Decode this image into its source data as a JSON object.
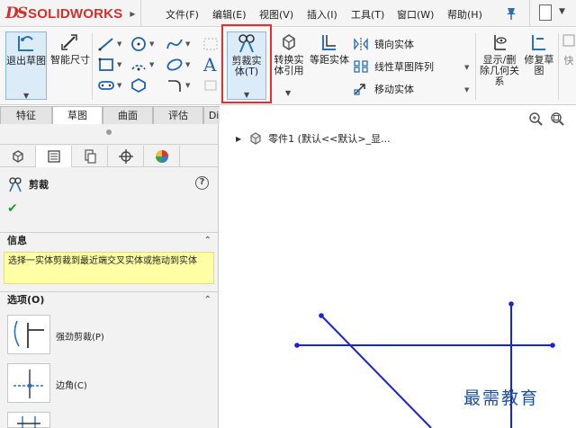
{
  "app": {
    "logo_text": "SOLIDWORKS",
    "logo_mark": "DS",
    "accent_color": "#d0312d"
  },
  "menu": {
    "items": [
      "文件(F)",
      "编辑(E)",
      "视图(V)",
      "插入(I)",
      "工具(T)",
      "窗口(W)",
      "帮助(H)"
    ]
  },
  "commands": {
    "exit_sketch": "退出草图",
    "smart_dim": "智能尺寸",
    "trim_entities": "剪裁实体(T)",
    "convert_entities": "转换实体引用",
    "offset_entities": "等距实体",
    "mirror_entities": "镜向实体",
    "linear_pattern": "线性草图阵列",
    "move_entities": "移动实体",
    "show_delete_relations": "显示/删除几何关系",
    "repair_sketch": "修复草图",
    "quick_snaps": "快"
  },
  "tabs": {
    "items": [
      "特征",
      "草图",
      "曲面",
      "评估",
      "DimXpert"
    ],
    "active": "草图"
  },
  "property_manager": {
    "title": "剪裁",
    "help": "?",
    "ok": "✔",
    "info_heading": "信息",
    "info_text": "选择一实体剪裁到最近端交叉实体或拖动到实体",
    "options_heading": "选项(O)",
    "options": [
      {
        "label": "强劲剪裁(P)"
      },
      {
        "label": "边角(C)"
      }
    ]
  },
  "feature_tree": {
    "part_label": "零件1  (默认<<默认>_显..."
  },
  "watermark": "最需教育"
}
